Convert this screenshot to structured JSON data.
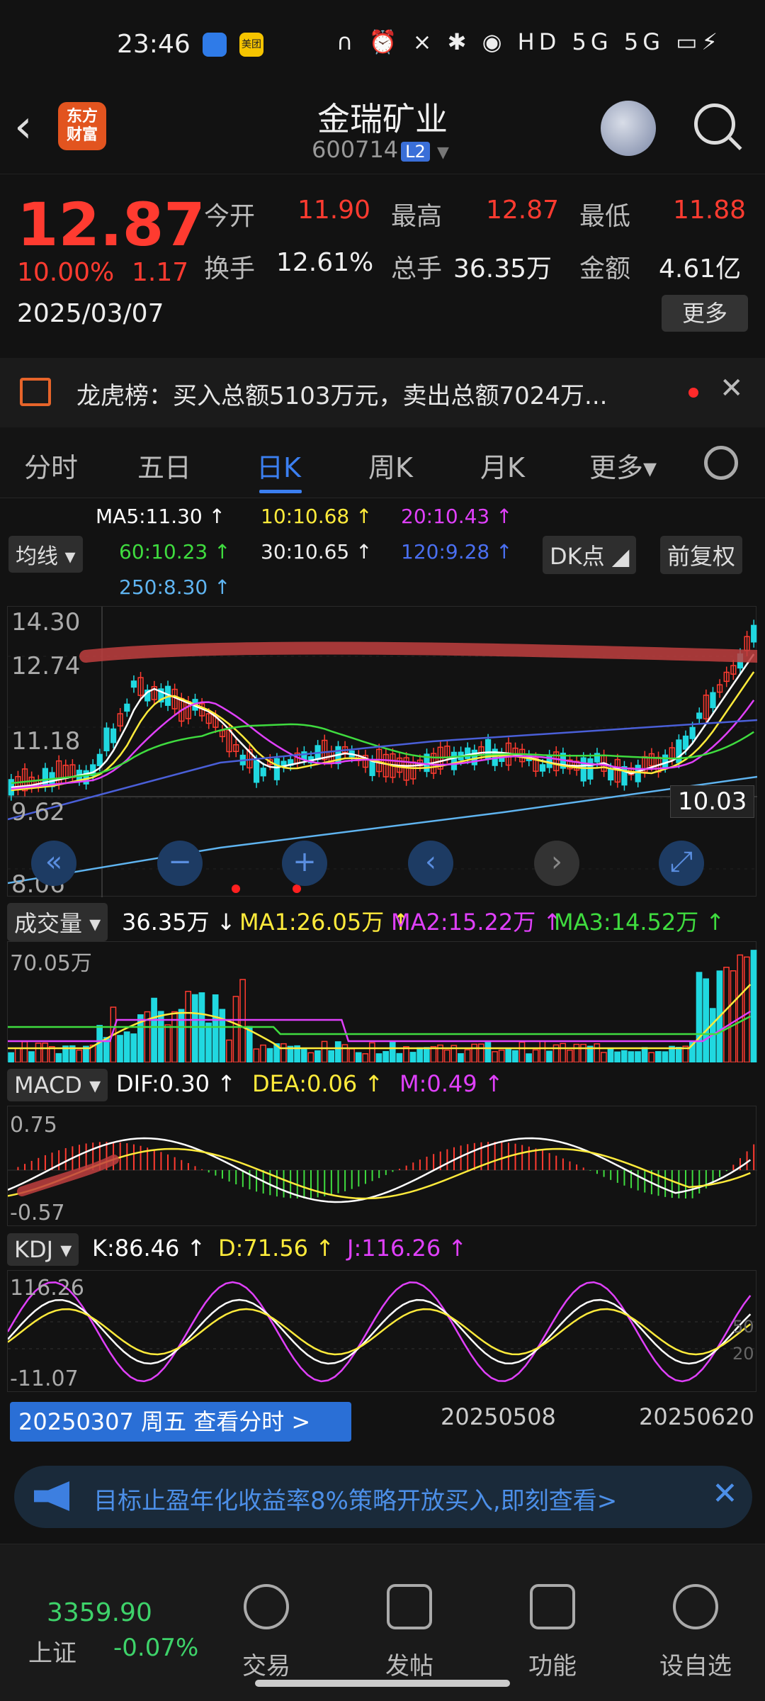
{
  "status_bar": {
    "time": "23:46",
    "icons": "∩ ⏰ × ✱ ◉ HD 5G 5G ▭⚡",
    "app2": "美团"
  },
  "header": {
    "title": "金瑞矿业",
    "code": "600714",
    "badge": "L2",
    "logo_line1": "东方",
    "logo_line2": "财富"
  },
  "quote": {
    "price": "12.87",
    "change_pct": "10.00%",
    "change": "1.17",
    "date": "2025/03/07",
    "open_label": "今开",
    "open": "11.90",
    "high_label": "最高",
    "high": "12.87",
    "low_label": "最低",
    "low": "11.88",
    "turnover_label": "换手",
    "turnover": "12.61%",
    "volume_label": "总手",
    "volume": "36.35万",
    "amount_label": "金额",
    "amount": "4.61亿",
    "more": "更多"
  },
  "notice": {
    "text": "龙虎榜：买入总额5103万元，卖出总额7024万..."
  },
  "tabs": [
    "分时",
    "五日",
    "日K",
    "周K",
    "月K",
    "更多▾"
  ],
  "ma_legend": {
    "ma5": "MA5:11.30 ↑",
    "ma10": "10:10.68 ↑",
    "ma20": "20:10.43 ↑",
    "ma60": "60:10.23 ↑",
    "ma30": "30:10.65 ↑",
    "ma120": "120:9.28 ↑",
    "ma250": "250:8.30 ↑",
    "junxian": "均线 ▾",
    "dk": "DK点 ◢",
    "fuquan": "前复权"
  },
  "price_axis": [
    "14.30",
    "12.74",
    "11.18",
    "9.62",
    "8.06"
  ],
  "cursor_price": "10.03",
  "volume": {
    "title": "成交量 ▾",
    "value": "36.35万 ↓",
    "ma1": "MA1:26.05万 ↑",
    "ma2": "MA2:15.22万 ↑",
    "ma3": "MA3:14.52万 ↑",
    "axis": "70.05万"
  },
  "macd": {
    "title": "MACD ▾",
    "dif": "DIF:0.30 ↑",
    "dea": "DEA:0.06 ↑",
    "m": "M:0.49 ↑",
    "top": "0.75",
    "bottom": "-0.57"
  },
  "kdj": {
    "title": "KDJ ▾",
    "k": "K:86.46 ↑",
    "d": "D:71.56 ↑",
    "j": "J:116.26 ↑",
    "top": "116.26",
    "bottom": "-11.07",
    "l50": "50",
    "l20": "20"
  },
  "footer_dates": {
    "btn": "20250307 周五 查看分时 >",
    "d2": "20250508",
    "d3": "20250620"
  },
  "ad": {
    "text": "目标止盈年化收益率8%策略开放买入,即刻查看>"
  },
  "bottom_nav": {
    "index_value": "3359.90",
    "index_name": "上证",
    "index_change": "-0.07%",
    "items": [
      "交易",
      "发帖",
      "功能",
      "设自选"
    ]
  },
  "colors": {
    "up": "#ff3b30",
    "down": "#20d8e0",
    "ma5": "#ffffff",
    "ma10": "#ffeb3b",
    "ma20": "#e040fb",
    "ma60": "#3fdc3f",
    "ma120": "#4a5fd8",
    "ma250": "#5fb4f0"
  }
}
